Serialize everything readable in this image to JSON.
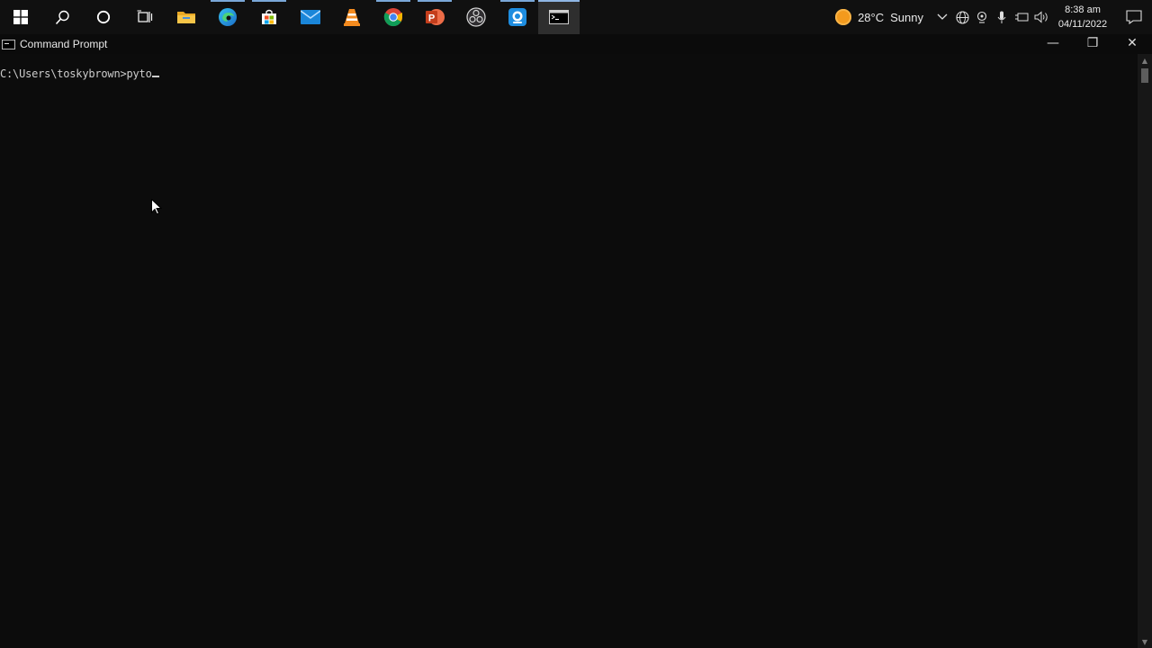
{
  "taskbar": {
    "items": [
      {
        "name": "start",
        "icon": "windows-logo-icon"
      },
      {
        "name": "search",
        "icon": "search-icon"
      },
      {
        "name": "cortana",
        "icon": "cortana-circle-icon"
      },
      {
        "name": "task-view",
        "icon": "task-view-icon"
      },
      {
        "name": "file-explorer",
        "icon": "folder-icon"
      },
      {
        "name": "edge",
        "icon": "edge-icon"
      },
      {
        "name": "store",
        "icon": "store-icon"
      },
      {
        "name": "mail",
        "icon": "mail-icon"
      },
      {
        "name": "vlc",
        "icon": "vlc-cone-icon"
      },
      {
        "name": "chrome",
        "icon": "chrome-icon"
      },
      {
        "name": "powerpoint",
        "icon": "powerpoint-icon"
      },
      {
        "name": "obs",
        "icon": "obs-icon"
      },
      {
        "name": "webcam",
        "icon": "camera-app-icon"
      },
      {
        "name": "command-prompt",
        "icon": "terminal-icon"
      }
    ],
    "weather": {
      "temp": "28°C",
      "condition": "Sunny"
    },
    "clock": {
      "time": "8:38 am",
      "date": "04/11/2022"
    }
  },
  "window": {
    "title": "Command Prompt",
    "controls": {
      "minimize": "—",
      "restore": "❐",
      "close": "✕"
    }
  },
  "console": {
    "prompt": "C:\\Users\\toskybrown>",
    "input": "pyto"
  },
  "colors": {
    "background": "#0c0c0c",
    "text": "#cccccc",
    "taskbar": "#101010",
    "accent": "#8fb6e4"
  }
}
